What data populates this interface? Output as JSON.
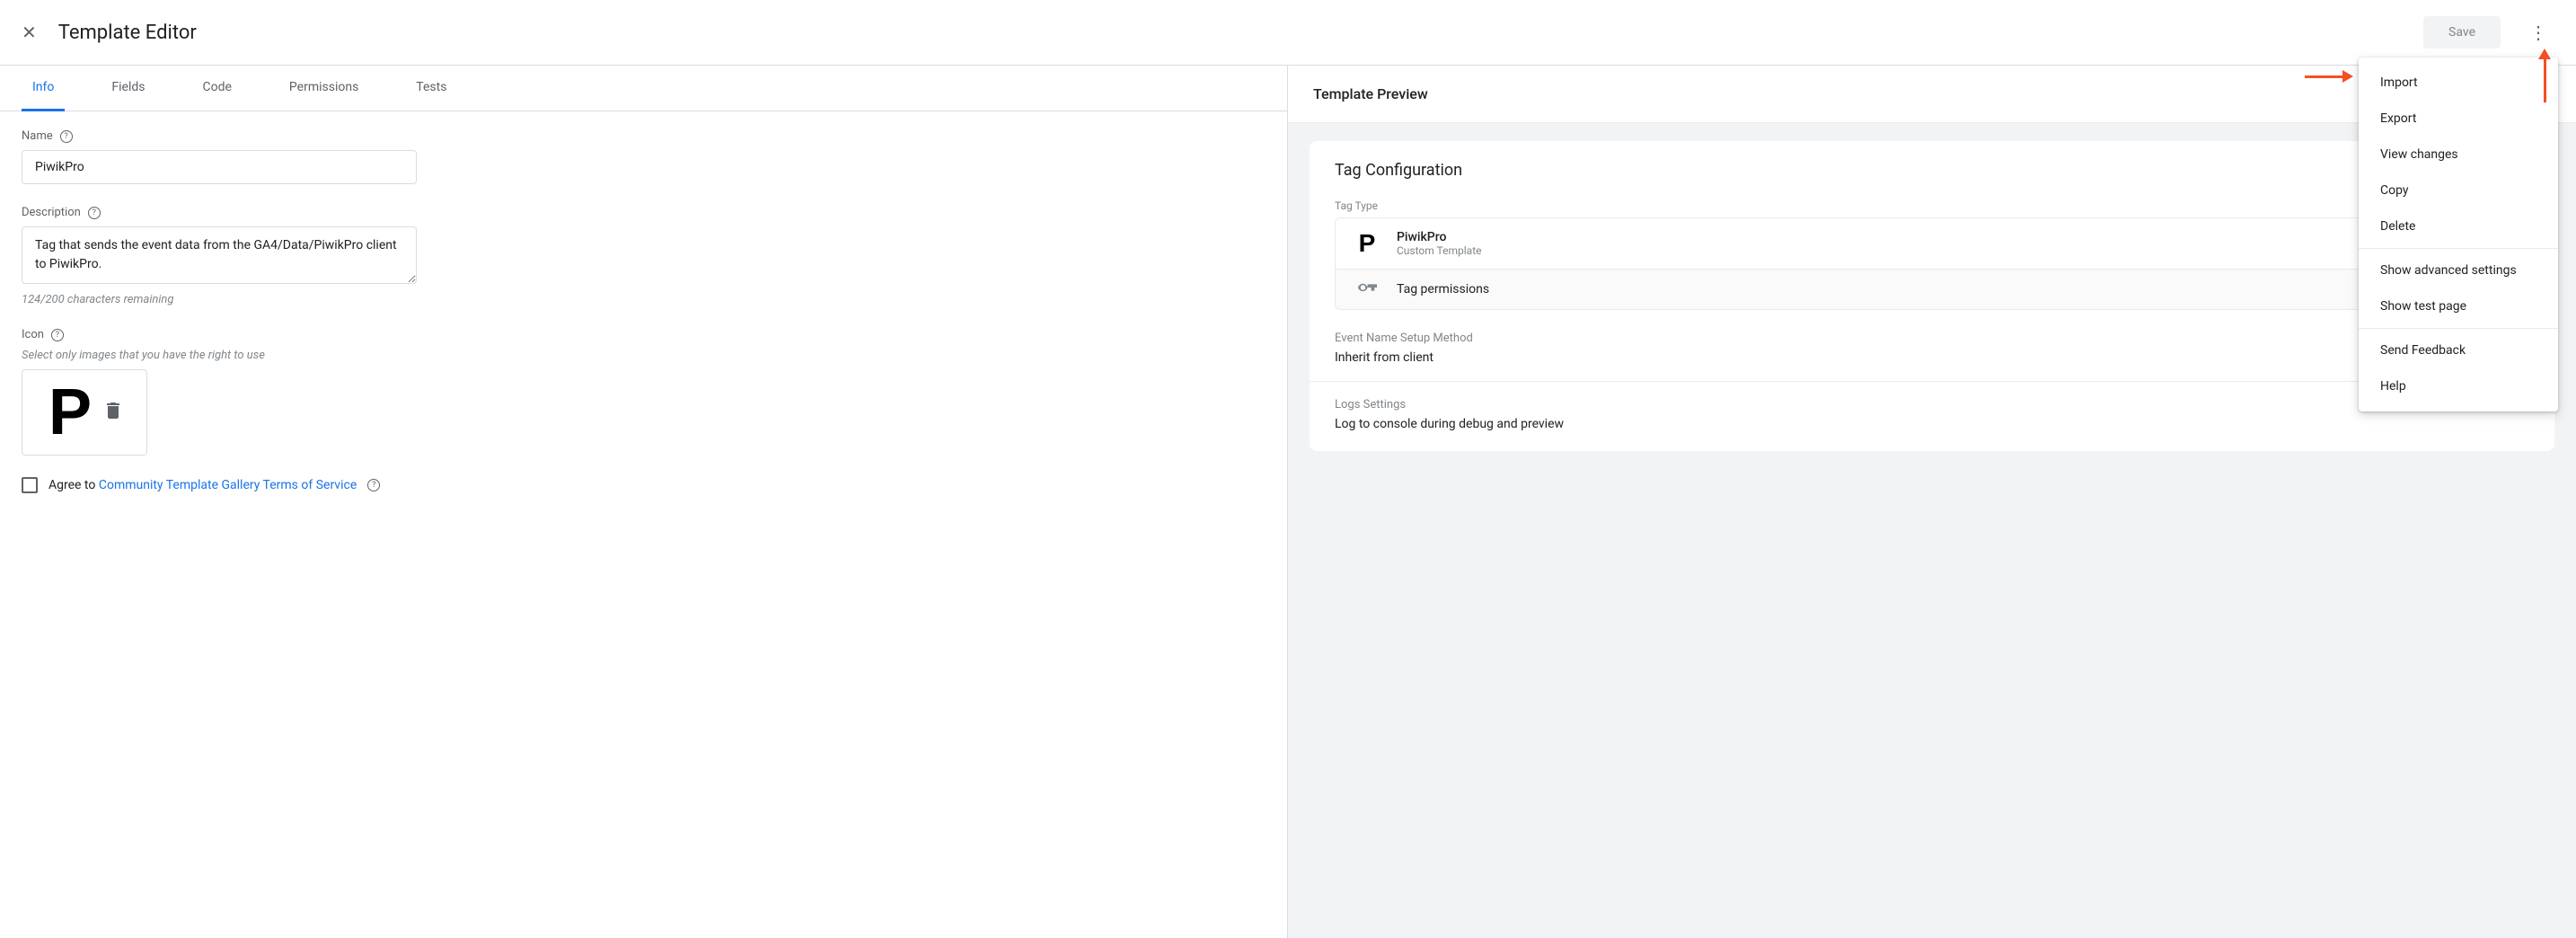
{
  "header": {
    "title": "Template Editor",
    "save_label": "Save"
  },
  "tabs": [
    "Info",
    "Fields",
    "Code",
    "Permissions",
    "Tests"
  ],
  "form": {
    "name_label": "Name",
    "name_value": "PiwikPro",
    "desc_label": "Description",
    "desc_value": "Tag that sends the event data from the GA4/Data/PiwikPro client to PiwikPro.",
    "desc_helper": "124/200 characters remaining",
    "icon_label": "Icon",
    "icon_helper": "Select only images that you have the right to use",
    "agree_prefix": "Agree to ",
    "agree_link": "Community Template Gallery Terms of Service"
  },
  "preview": {
    "header": "Template Preview",
    "card_title": "Tag Configuration",
    "tag_type_label": "Tag Type",
    "tag_name": "PiwikPro",
    "tag_sub": "Custom Template",
    "permissions_label": "Tag permissions",
    "event_label": "Event Name Setup Method",
    "event_value": "Inherit from client",
    "logs_label": "Logs Settings",
    "logs_value": "Log to console during debug and preview"
  },
  "menu": {
    "import": "Import",
    "export": "Export",
    "view_changes": "View changes",
    "copy": "Copy",
    "delete": "Delete",
    "show_advanced": "Show advanced settings",
    "show_test": "Show test page",
    "feedback": "Send Feedback",
    "help": "Help"
  }
}
